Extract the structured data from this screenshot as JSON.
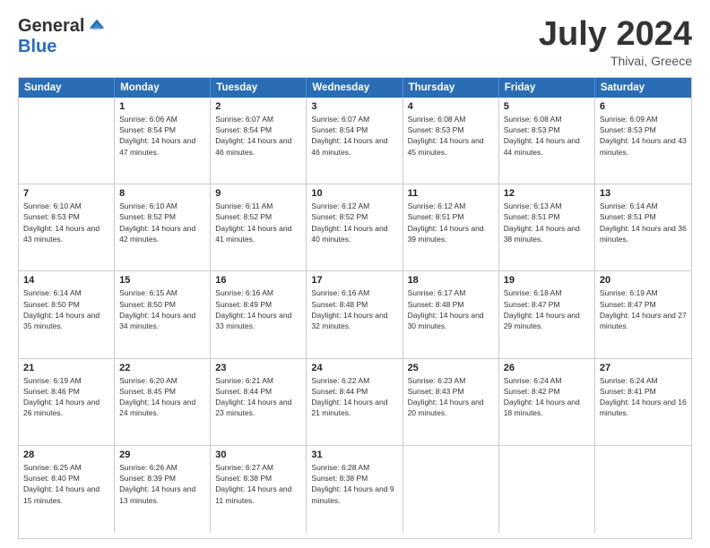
{
  "logo": {
    "general": "General",
    "blue": "Blue"
  },
  "title": "July 2024",
  "subtitle": "Thivai, Greece",
  "header_days": [
    "Sunday",
    "Monday",
    "Tuesday",
    "Wednesday",
    "Thursday",
    "Friday",
    "Saturday"
  ],
  "weeks": [
    [
      {
        "day": "",
        "sunrise": "",
        "sunset": "",
        "daylight": ""
      },
      {
        "day": "1",
        "sunrise": "Sunrise: 6:06 AM",
        "sunset": "Sunset: 8:54 PM",
        "daylight": "Daylight: 14 hours and 47 minutes."
      },
      {
        "day": "2",
        "sunrise": "Sunrise: 6:07 AM",
        "sunset": "Sunset: 8:54 PM",
        "daylight": "Daylight: 14 hours and 46 minutes."
      },
      {
        "day": "3",
        "sunrise": "Sunrise: 6:07 AM",
        "sunset": "Sunset: 8:54 PM",
        "daylight": "Daylight: 14 hours and 46 minutes."
      },
      {
        "day": "4",
        "sunrise": "Sunrise: 6:08 AM",
        "sunset": "Sunset: 8:53 PM",
        "daylight": "Daylight: 14 hours and 45 minutes."
      },
      {
        "day": "5",
        "sunrise": "Sunrise: 6:08 AM",
        "sunset": "Sunset: 8:53 PM",
        "daylight": "Daylight: 14 hours and 44 minutes."
      },
      {
        "day": "6",
        "sunrise": "Sunrise: 6:09 AM",
        "sunset": "Sunset: 8:53 PM",
        "daylight": "Daylight: 14 hours and 43 minutes."
      }
    ],
    [
      {
        "day": "7",
        "sunrise": "Sunrise: 6:10 AM",
        "sunset": "Sunset: 8:53 PM",
        "daylight": "Daylight: 14 hours and 43 minutes."
      },
      {
        "day": "8",
        "sunrise": "Sunrise: 6:10 AM",
        "sunset": "Sunset: 8:52 PM",
        "daylight": "Daylight: 14 hours and 42 minutes."
      },
      {
        "day": "9",
        "sunrise": "Sunrise: 6:11 AM",
        "sunset": "Sunset: 8:52 PM",
        "daylight": "Daylight: 14 hours and 41 minutes."
      },
      {
        "day": "10",
        "sunrise": "Sunrise: 6:12 AM",
        "sunset": "Sunset: 8:52 PM",
        "daylight": "Daylight: 14 hours and 40 minutes."
      },
      {
        "day": "11",
        "sunrise": "Sunrise: 6:12 AM",
        "sunset": "Sunset: 8:51 PM",
        "daylight": "Daylight: 14 hours and 39 minutes."
      },
      {
        "day": "12",
        "sunrise": "Sunrise: 6:13 AM",
        "sunset": "Sunset: 8:51 PM",
        "daylight": "Daylight: 14 hours and 38 minutes."
      },
      {
        "day": "13",
        "sunrise": "Sunrise: 6:14 AM",
        "sunset": "Sunset: 8:51 PM",
        "daylight": "Daylight: 14 hours and 36 minutes."
      }
    ],
    [
      {
        "day": "14",
        "sunrise": "Sunrise: 6:14 AM",
        "sunset": "Sunset: 8:50 PM",
        "daylight": "Daylight: 14 hours and 35 minutes."
      },
      {
        "day": "15",
        "sunrise": "Sunrise: 6:15 AM",
        "sunset": "Sunset: 8:50 PM",
        "daylight": "Daylight: 14 hours and 34 minutes."
      },
      {
        "day": "16",
        "sunrise": "Sunrise: 6:16 AM",
        "sunset": "Sunset: 8:49 PM",
        "daylight": "Daylight: 14 hours and 33 minutes."
      },
      {
        "day": "17",
        "sunrise": "Sunrise: 6:16 AM",
        "sunset": "Sunset: 8:48 PM",
        "daylight": "Daylight: 14 hours and 32 minutes."
      },
      {
        "day": "18",
        "sunrise": "Sunrise: 6:17 AM",
        "sunset": "Sunset: 8:48 PM",
        "daylight": "Daylight: 14 hours and 30 minutes."
      },
      {
        "day": "19",
        "sunrise": "Sunrise: 6:18 AM",
        "sunset": "Sunset: 8:47 PM",
        "daylight": "Daylight: 14 hours and 29 minutes."
      },
      {
        "day": "20",
        "sunrise": "Sunrise: 6:19 AM",
        "sunset": "Sunset: 8:47 PM",
        "daylight": "Daylight: 14 hours and 27 minutes."
      }
    ],
    [
      {
        "day": "21",
        "sunrise": "Sunrise: 6:19 AM",
        "sunset": "Sunset: 8:46 PM",
        "daylight": "Daylight: 14 hours and 26 minutes."
      },
      {
        "day": "22",
        "sunrise": "Sunrise: 6:20 AM",
        "sunset": "Sunset: 8:45 PM",
        "daylight": "Daylight: 14 hours and 24 minutes."
      },
      {
        "day": "23",
        "sunrise": "Sunrise: 6:21 AM",
        "sunset": "Sunset: 8:44 PM",
        "daylight": "Daylight: 14 hours and 23 minutes."
      },
      {
        "day": "24",
        "sunrise": "Sunrise: 6:22 AM",
        "sunset": "Sunset: 8:44 PM",
        "daylight": "Daylight: 14 hours and 21 minutes."
      },
      {
        "day": "25",
        "sunrise": "Sunrise: 6:23 AM",
        "sunset": "Sunset: 8:43 PM",
        "daylight": "Daylight: 14 hours and 20 minutes."
      },
      {
        "day": "26",
        "sunrise": "Sunrise: 6:24 AM",
        "sunset": "Sunset: 8:42 PM",
        "daylight": "Daylight: 14 hours and 18 minutes."
      },
      {
        "day": "27",
        "sunrise": "Sunrise: 6:24 AM",
        "sunset": "Sunset: 8:41 PM",
        "daylight": "Daylight: 14 hours and 16 minutes."
      }
    ],
    [
      {
        "day": "28",
        "sunrise": "Sunrise: 6:25 AM",
        "sunset": "Sunset: 8:40 PM",
        "daylight": "Daylight: 14 hours and 15 minutes."
      },
      {
        "day": "29",
        "sunrise": "Sunrise: 6:26 AM",
        "sunset": "Sunset: 8:39 PM",
        "daylight": "Daylight: 14 hours and 13 minutes."
      },
      {
        "day": "30",
        "sunrise": "Sunrise: 6:27 AM",
        "sunset": "Sunset: 8:38 PM",
        "daylight": "Daylight: 14 hours and 11 minutes."
      },
      {
        "day": "31",
        "sunrise": "Sunrise: 6:28 AM",
        "sunset": "Sunset: 8:38 PM",
        "daylight": "Daylight: 14 hours and 9 minutes."
      },
      {
        "day": "",
        "sunrise": "",
        "sunset": "",
        "daylight": ""
      },
      {
        "day": "",
        "sunrise": "",
        "sunset": "",
        "daylight": ""
      },
      {
        "day": "",
        "sunrise": "",
        "sunset": "",
        "daylight": ""
      }
    ]
  ]
}
